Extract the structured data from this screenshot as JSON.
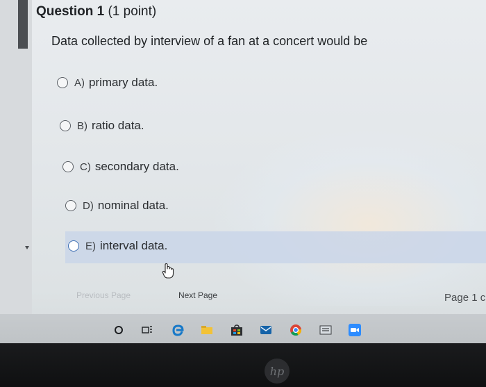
{
  "question": {
    "title": "Question 1",
    "points": "(1 point)",
    "prompt": "Data collected by interview of a fan at a concert would be"
  },
  "options": [
    {
      "letter": "A)",
      "text": "primary data."
    },
    {
      "letter": "B)",
      "text": "ratio data."
    },
    {
      "letter": "C)",
      "text": "secondary data."
    },
    {
      "letter": "D)",
      "text": "nominal data."
    },
    {
      "letter": "E)",
      "text": "interval data."
    }
  ],
  "navigation": {
    "previous_label": "Previous Page",
    "next_label": "Next Page",
    "page_label": "Page 1 c"
  },
  "taskbar": {
    "icons": [
      "search-icon",
      "task-view-icon",
      "edge-icon",
      "file-explorer-icon",
      "store-icon",
      "mail-icon",
      "chrome-icon",
      "news-icon",
      "zoom-icon"
    ]
  },
  "bezel": {
    "logo": "hp"
  }
}
